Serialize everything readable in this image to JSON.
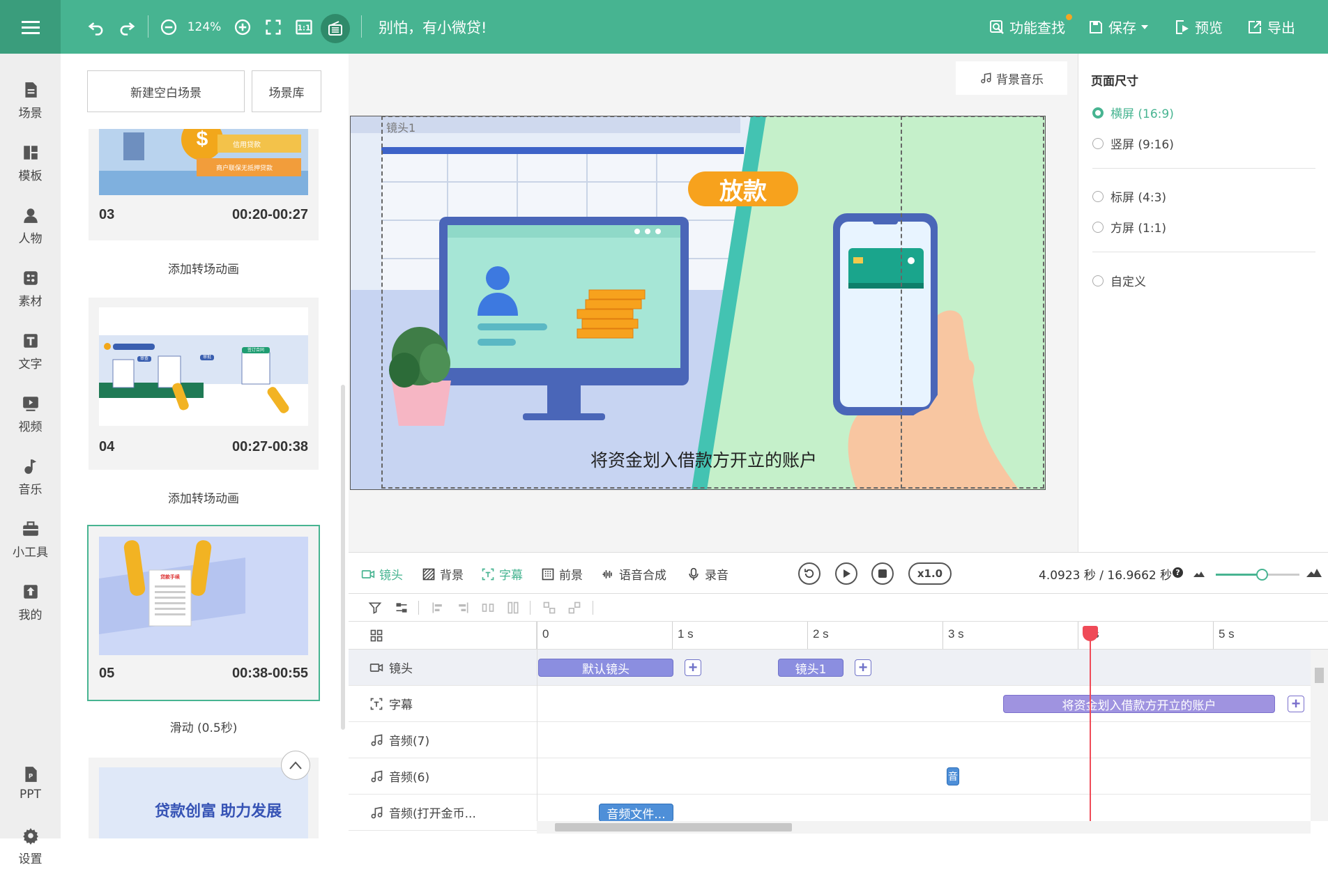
{
  "topbar": {
    "zoom": "124%",
    "slogan": "别怕，有小微贷!",
    "search_label": "功能查找",
    "save_label": "保存",
    "preview_label": "预览",
    "export_label": "导出",
    "accent": "#47b491"
  },
  "sidebar": {
    "items": [
      {
        "label": "场景",
        "icon": "scene-icon"
      },
      {
        "label": "模板",
        "icon": "template-icon"
      },
      {
        "label": "人物",
        "icon": "person-icon"
      },
      {
        "label": "素材",
        "icon": "material-icon"
      },
      {
        "label": "文字",
        "icon": "text-icon"
      },
      {
        "label": "视频",
        "icon": "video-icon"
      },
      {
        "label": "音乐",
        "icon": "music-icon"
      },
      {
        "label": "小工具",
        "icon": "toolbox-icon"
      },
      {
        "label": "我的",
        "icon": "upload-icon"
      },
      {
        "label": "PPT",
        "icon": "ppt-icon"
      },
      {
        "label": "设置",
        "icon": "gear-icon"
      }
    ]
  },
  "scenes": {
    "new_blank": "新建空白场景",
    "library": "场景库",
    "cards": [
      {
        "num": "03",
        "time": "00:20-00:27",
        "transition": "添加转场动画",
        "thumb_text": [
          "信用贷款",
          "商户联保无抵押贷款"
        ]
      },
      {
        "num": "04",
        "time": "00:27-00:38",
        "transition": "添加转场动画",
        "thumb_text": [
          "审查",
          "审批",
          "签订合同"
        ]
      },
      {
        "num": "05",
        "time": "00:38-00:55",
        "transition": "滑动 (0.5秒)",
        "thumb_text": [
          "贷款手续"
        ]
      },
      {
        "thumb_text": [
          "贷款创富 助力发展"
        ]
      }
    ]
  },
  "canvas": {
    "bgm_label": "背景音乐",
    "lens_label": "镜头1",
    "badge": "放款",
    "caption": "将资金划入借款方开立的账户"
  },
  "page_size": {
    "title": "页面尺寸",
    "options": [
      {
        "label": "横屏 (16:9)",
        "selected": true
      },
      {
        "label": "竖屏 (9:16)",
        "selected": false
      },
      {
        "label": "标屏 (4:3)",
        "selected": false
      },
      {
        "label": "方屏 (1:1)",
        "selected": false
      },
      {
        "label": "自定义",
        "selected": false
      }
    ]
  },
  "timeline": {
    "tabs": [
      {
        "label": "镜头",
        "active": true
      },
      {
        "label": "背景",
        "active": false
      },
      {
        "label": "字幕",
        "active": true
      },
      {
        "label": "前景",
        "active": false
      },
      {
        "label": "语音合成",
        "active": false
      },
      {
        "label": "录音",
        "active": false
      }
    ],
    "speed": "x1.0",
    "time_readout": "4.0923 秒 / 16.9662 秒",
    "current_time_sec": 4.0923,
    "total_time_sec": 16.9662,
    "zoom_level": 0.55,
    "ticks": [
      "0",
      "1 s",
      "2 s",
      "3 s",
      "4 s",
      "5 s"
    ],
    "tracks": [
      {
        "label": "镜头",
        "icon": "camera-icon"
      },
      {
        "label": "字幕",
        "icon": "subtitle-icon"
      },
      {
        "label": "音频(7)",
        "icon": "music-note-icon"
      },
      {
        "label": "音频(6)",
        "icon": "music-note-icon"
      },
      {
        "label": "音频(打开金币...",
        "icon": "music-note-icon"
      }
    ],
    "clips": {
      "default_lens": "默认镜头",
      "lens1": "镜头1",
      "subtitle": "将资金划入借款方开立的账户",
      "audio6": "音",
      "audio_coin": "音频文件..."
    }
  }
}
